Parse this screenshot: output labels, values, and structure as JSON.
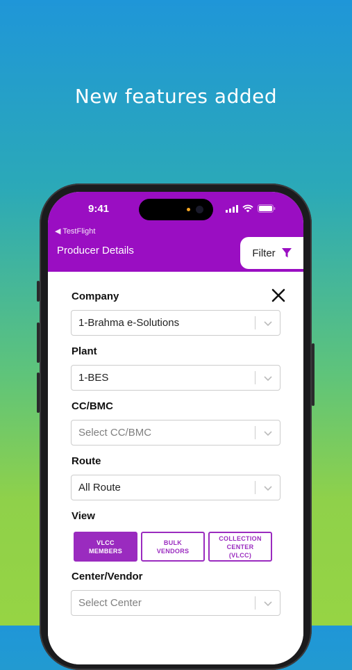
{
  "headline": "New features added",
  "status_bar": {
    "time": "9:41"
  },
  "nav": {
    "back_label": "◀ TestFlight",
    "title": "Producer Details",
    "filter_label": "Filter"
  },
  "filter_panel": {
    "fields": [
      {
        "label": "Company",
        "value": "1-Brahma e-Solutions",
        "placeholder": ""
      },
      {
        "label": "Plant",
        "value": "1-BES",
        "placeholder": ""
      },
      {
        "label": "CC/BMC",
        "value": "",
        "placeholder": "Select CC/BMC"
      },
      {
        "label": "Route",
        "value": "All Route",
        "placeholder": ""
      }
    ],
    "view": {
      "label": "View",
      "options": [
        {
          "line1": "VLCC",
          "line2": "MEMBERS",
          "line3": "",
          "selected": true
        },
        {
          "line1": "BULK",
          "line2": "VENDORS",
          "line3": "",
          "selected": false
        },
        {
          "line1": "COLLECTION",
          "line2": "CENTER",
          "line3": "(VLCC)",
          "selected": false
        }
      ]
    },
    "center_vendor": {
      "label": "Center/Vendor",
      "value": "",
      "placeholder": "Select Center"
    }
  },
  "colors": {
    "accent": "#9a0ec2",
    "view_button": "#9a2bbf"
  }
}
